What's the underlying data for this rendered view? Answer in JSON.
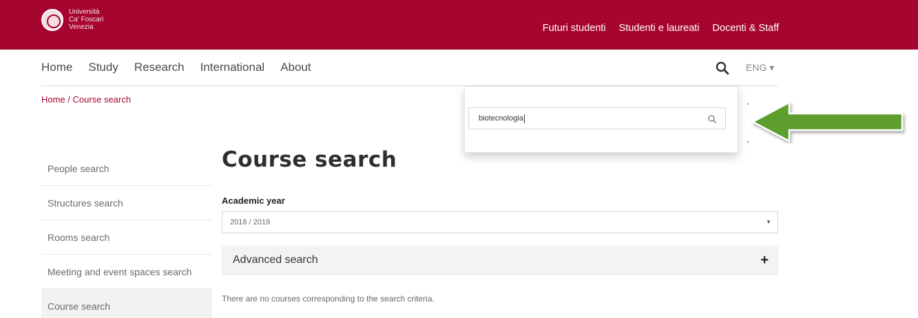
{
  "header": {
    "logo_lines": [
      "Università",
      "Ca' Foscari",
      "Venezia"
    ],
    "top_links": [
      "Futuri studenti",
      "Studenti e laureati",
      "Docenti & Staff"
    ],
    "accent_color": "#a6052e"
  },
  "nav": {
    "items": [
      "Home",
      "Study",
      "Research",
      "International",
      "About"
    ],
    "search_icon": "search-icon",
    "language": "ENG ▾"
  },
  "breadcrumb": "Home / Course search",
  "search_popup": {
    "value": "biotecnologia",
    "icon": "search-icon"
  },
  "page_title": "Course search",
  "sidebar": {
    "items": [
      {
        "label": "People search",
        "active": false
      },
      {
        "label": "Structures search",
        "active": false
      },
      {
        "label": "Rooms search",
        "active": false
      },
      {
        "label": "Meeting and event spaces search",
        "active": false
      },
      {
        "label": "Course search",
        "active": true
      }
    ]
  },
  "form": {
    "academic_year_label": "Academic year",
    "academic_year_value": "2018 / 2019",
    "advanced_search_label": "Advanced search",
    "advanced_search_icon": "+"
  },
  "results": {
    "message": "There are no courses corresponding to the search criteria."
  },
  "annotation": {
    "arrow_color": "#5d9e2d"
  }
}
